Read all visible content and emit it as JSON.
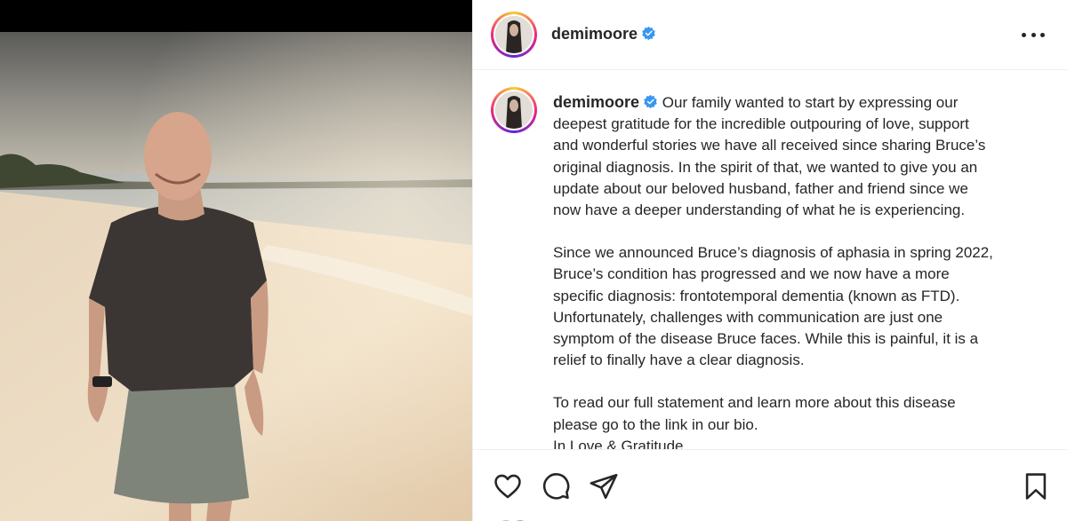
{
  "post": {
    "username": "demimoore",
    "caption_username": "demimoore",
    "caption_lines": [
      "Our family wanted to start by expressing our",
      "deepest gratitude for the incredible outpouring of love, support",
      "and wonderful stories we have all received since sharing Bruce’s",
      "original diagnosis. In the spirit of that, we wanted to give you an",
      "update about our beloved husband, father and friend since we",
      "now have a deeper understanding of what he is experiencing."
    ],
    "paragraph2": [
      "Since we announced Bruce’s diagnosis of aphasia in spring 2022,",
      "Bruce’s condition has progressed and we now have a more",
      "specific diagnosis: frontotemporal dementia (known as FTD).",
      "Unfortunately, challenges with communication are just one",
      "symptom of the disease Bruce faces. While this is painful, it is a",
      "relief to finally have a clear diagnosis."
    ],
    "paragraph3": [
      "To read our full statement and learn more about this disease",
      "please go to the link in our bio.",
      "In Love & Gratitude"
    ]
  },
  "icons": {
    "verified": "verified-badge-icon",
    "more": "more-options-icon",
    "like": "heart-icon",
    "comment": "comment-icon",
    "share": "paper-plane-icon",
    "save": "bookmark-icon"
  },
  "colors": {
    "verified": "#3897f0",
    "text": "#262626",
    "divider": "#efefef"
  }
}
